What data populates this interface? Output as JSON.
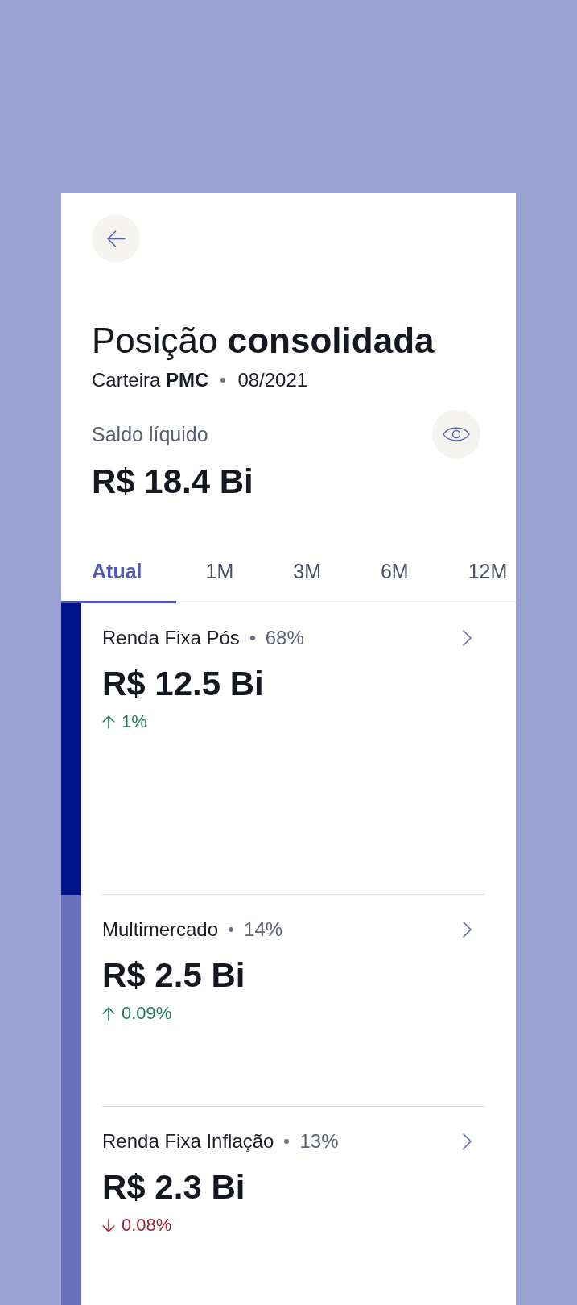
{
  "title": "Posição **consolidada**",
  "subtitle": {
    "portfolio": "Carteira **PMC**",
    "date": "08/2021"
  },
  "balance": {
    "label": "Saldo líquido",
    "value": "R$ 18.4 Bi"
  },
  "tabs": [
    {
      "label": "Atual",
      "selected": true
    },
    {
      "label": "1M",
      "selected": false
    },
    {
      "label": "3M",
      "selected": false
    },
    {
      "label": "6M",
      "selected": false
    },
    {
      "label": "12M",
      "selected": false
    }
  ],
  "categories": [
    {
      "name": "Renda Fixa Pós",
      "share": "68%",
      "value": "R$ 12.5 Bi",
      "rising": true,
      "change": "1%",
      "color": "#001489"
    },
    {
      "name": "Multimercado",
      "share": "14%",
      "value": "R$ 2.5 Bi",
      "rising": true,
      "change": "0.09%",
      "color": "#6872bd"
    },
    {
      "name": "Renda Fixa Inflação",
      "share": "13%",
      "value": "R$ 2.3 Bi",
      "rising": false,
      "change": "0.08%",
      "color": "#6872bd"
    }
  ]
}
